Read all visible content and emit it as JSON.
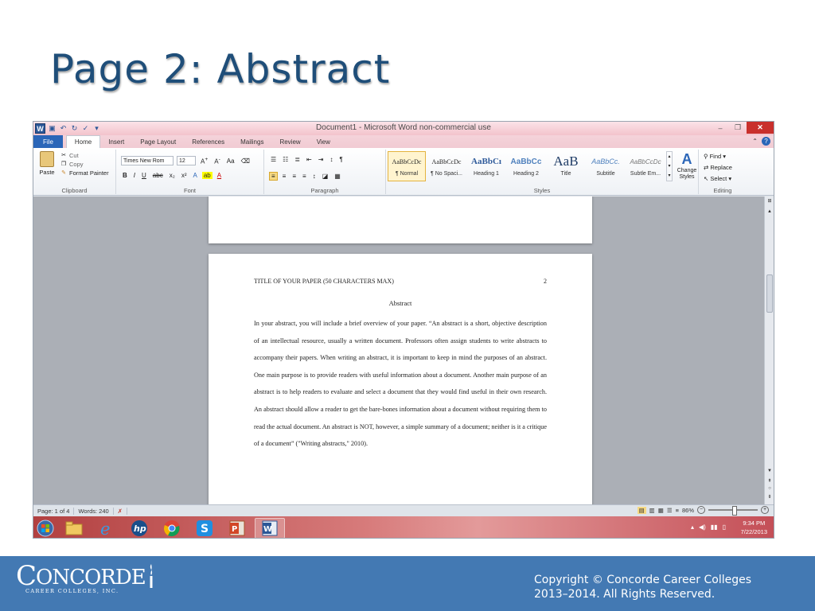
{
  "slide": {
    "title": "Page 2: Abstract",
    "copyright_line1": "Copyright © Concorde Career Colleges",
    "copyright_line2": "2013–2014. All Rights Reserved.",
    "logo_text": "ONCORDE",
    "logo_initial": "C",
    "logo_sub": "CAREER COLLEGES, INC."
  },
  "window": {
    "title": "Document1 - Microsoft Word non-commercial use",
    "minimize": "–",
    "maximize": "❐",
    "close": "✕"
  },
  "tabs": [
    "File",
    "Home",
    "Insert",
    "Page Layout",
    "References",
    "Mailings",
    "Review",
    "View"
  ],
  "ribbon": {
    "clipboard": {
      "paste": "Paste",
      "cut": "Cut",
      "copy": "Copy",
      "format_painter": "Format Painter",
      "label": "Clipboard"
    },
    "font": {
      "name": "Times New Rom",
      "size": "12",
      "label": "Font"
    },
    "paragraph": {
      "label": "Paragraph"
    },
    "styles": {
      "items": [
        {
          "sample": "AaBbCcDc",
          "name": "¶ Normal"
        },
        {
          "sample": "AaBbCcDc",
          "name": "¶ No Spaci..."
        },
        {
          "sample": "AaBbCı",
          "name": "Heading 1"
        },
        {
          "sample": "AaBbCc",
          "name": "Heading 2"
        },
        {
          "sample": "AaB",
          "name": "Title"
        },
        {
          "sample": "AaBbCc.",
          "name": "Subtitle"
        },
        {
          "sample": "AaBbCcDc",
          "name": "Subtle Em..."
        }
      ],
      "change_styles": "Change Styles",
      "label": "Styles"
    },
    "editing": {
      "find": "Find",
      "replace": "Replace",
      "select": "Select",
      "label": "Editing"
    }
  },
  "document": {
    "header_title": "TITLE OF YOUR PAPER (50 CHARACTERS MAX)",
    "page_number": "2",
    "heading": "Abstract",
    "body": "In your abstract, you will include a brief overview of your paper. “An abstract is a short, objective description of an intellectual resource, usually a written document. Professors often assign students to write abstracts to accompany their papers. When writing an abstract, it is important to keep in mind the purposes of an abstract. One main purpose is to provide readers with useful information about a document. Another main purpose of an abstract is to help readers to evaluate and select a document that they would find useful in their own research. An abstract should allow a reader to get the bare-bones information about a document without requiring them to read the actual document. An abstract is NOT, however, a simple summary of a document; neither is it a critique of a document” (\"Writing abstracts,\" 2010)."
  },
  "status": {
    "page": "Page: 1 of 4",
    "words": "Words: 240",
    "zoom": "86%"
  },
  "taskbar": {
    "time": "9:34 PM",
    "date": "7/22/2013"
  },
  "colors": {
    "title": "#1f4e79",
    "footer": "#4379b3",
    "file_tab": "#2b66b8",
    "taskbar": "#c44f57"
  }
}
